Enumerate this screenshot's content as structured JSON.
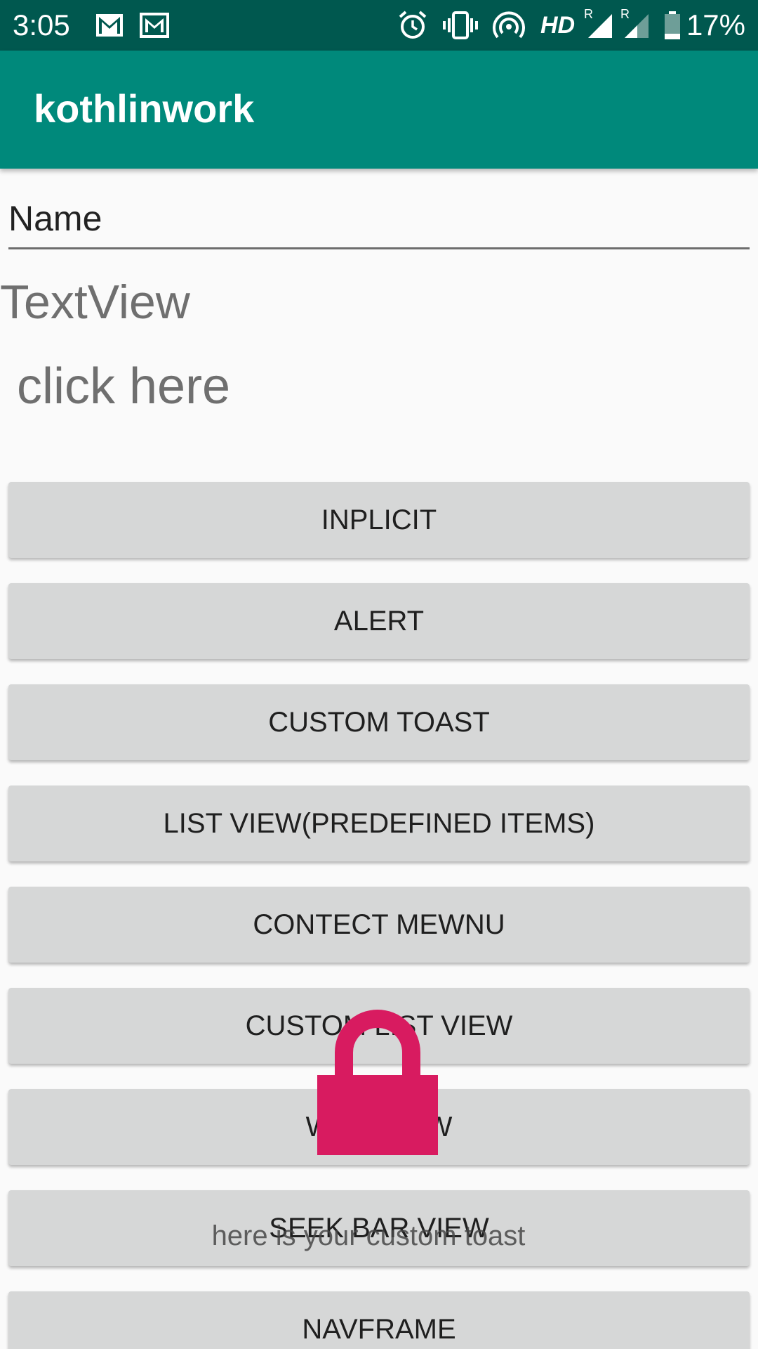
{
  "status_bar": {
    "time": "3:05",
    "battery_percent": "17%",
    "network_label": "HD",
    "roaming_label": "R",
    "icons": [
      "gmail-icon",
      "gmail-icon",
      "alarm-icon",
      "vibrate-icon",
      "hotspot-icon",
      "signal-icon",
      "signal-icon",
      "battery-icon"
    ]
  },
  "app_bar": {
    "title": "kothlinwork"
  },
  "form": {
    "name_value": "Name"
  },
  "labels": {
    "textview": "TextView",
    "click_here": "click here"
  },
  "buttons": [
    {
      "label": "INPLICIT"
    },
    {
      "label": "ALERT"
    },
    {
      "label": "CUSTOM TOAST"
    },
    {
      "label": "LIST VIEW(PREDEFINED ITEMS)"
    },
    {
      "label": "CONTECT MEWNU"
    },
    {
      "label": "CUSTOM LIST VIEW"
    },
    {
      "label": "W            W"
    },
    {
      "label": "SEEK BAR VIEW"
    },
    {
      "label": "NAVFRAME"
    }
  ],
  "toast": {
    "icon": "lock-icon",
    "text": "here is your custom toast",
    "icon_color": "#d81b60"
  },
  "colors": {
    "status_bar": "#00584f",
    "app_bar": "#00897b",
    "button_bg": "#d6d7d7"
  }
}
